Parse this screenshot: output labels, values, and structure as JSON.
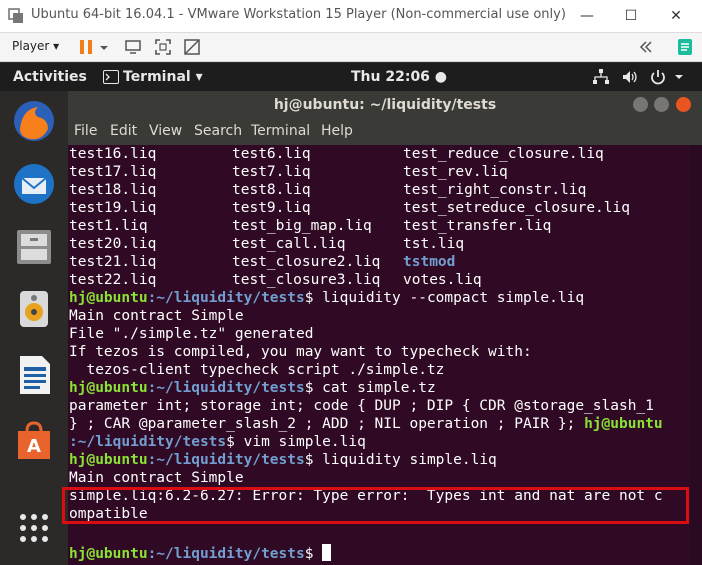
{
  "window": {
    "title": "Ubuntu 64-bit 16.04.1 - VMware Workstation 15 Player (Non-commercial use only)",
    "controls": {
      "minimize": "—",
      "maximize": "☐",
      "close": "✕"
    }
  },
  "toolbar": {
    "player_label": "Player ▾"
  },
  "topbar": {
    "activities": "Activities",
    "app_menu": "Terminal ▾",
    "clock": "Thu 22:06 ●"
  },
  "terminal": {
    "title": "hj@ubuntu: ~/liquidity/tests",
    "menu": [
      "File",
      "Edit",
      "View",
      "Search",
      "Terminal",
      "Help"
    ],
    "listing": [
      [
        "test16.liq",
        "test6.liq",
        "test_reduce_closure.liq"
      ],
      [
        "test17.liq",
        "test7.liq",
        "test_rev.liq"
      ],
      [
        "test18.liq",
        "test8.liq",
        "test_right_constr.liq"
      ],
      [
        "test19.liq",
        "test9.liq",
        "test_setreduce_closure.liq"
      ],
      [
        "test1.liq",
        "test_big_map.liq",
        "test_transfer.liq"
      ],
      [
        "test20.liq",
        "test_call.liq",
        "tst.liq"
      ],
      [
        "test21.liq",
        "test_closure2.liq",
        "tstmod"
      ],
      [
        "test22.liq",
        "test_closure3.liq",
        "votes.liq"
      ]
    ],
    "prompt_user": "hj@ubuntu",
    "prompt_path": ":~/liquidity/tests",
    "prompt_end": "$",
    "cmd1": " liquidity --compact simple.liq",
    "out1": "Main contract Simple",
    "out2": "File \"./simple.tz\" generated",
    "out3": "If tezos is compiled, you may want to typecheck with:",
    "out4": "  tezos-client typecheck script ./simple.tz",
    "cmd2": " cat simple.tz",
    "out5": "parameter int; storage int; code { DUP ; DIP { CDR @storage_slash_1",
    "out6a": "} ; CAR @parameter_slash_2 ; ADD ; NIL operation ; PAIR }; ",
    "out7_path": ":~/liquidity/tests",
    "cmd3": " vim simple.liq",
    "cmd4": " liquidity simple.liq",
    "out8": "Main contract Simple",
    "err1": "simple.liq:6.2-6.27: Error: Type error:  Types int and nat are not c",
    "err2": "ompatible"
  },
  "colors": {
    "terminal_bg": "#300a24",
    "prompt_user": "#8ae234",
    "prompt_path": "#729fcf",
    "highlight_box": "#d90d12"
  }
}
